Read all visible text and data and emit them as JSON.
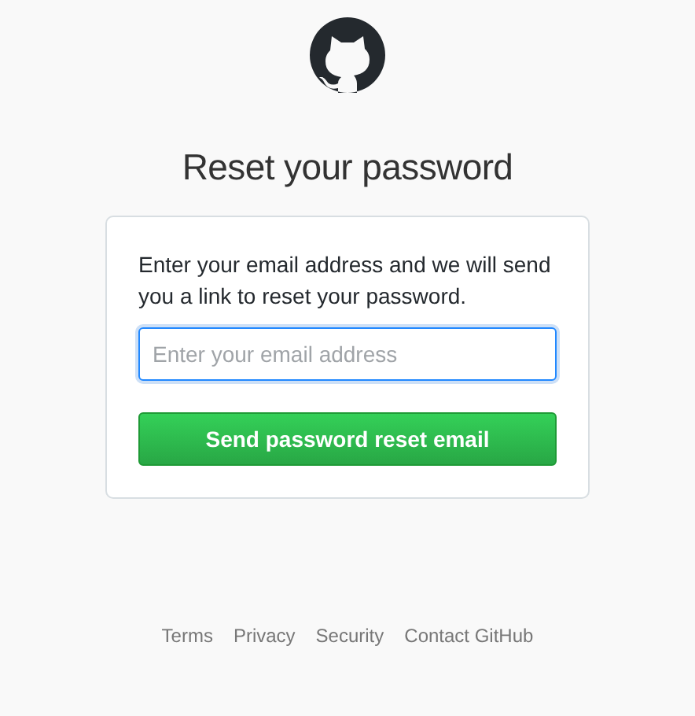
{
  "title": "Reset your password",
  "form": {
    "instructions": "Enter your email address and we will send you a link to reset your password.",
    "email_field": {
      "placeholder": "Enter your email address",
      "focused": true
    },
    "submit_button": "Send password reset email"
  },
  "footer_links": [
    "Terms",
    "Privacy",
    "Security",
    "Contact GitHub"
  ]
}
